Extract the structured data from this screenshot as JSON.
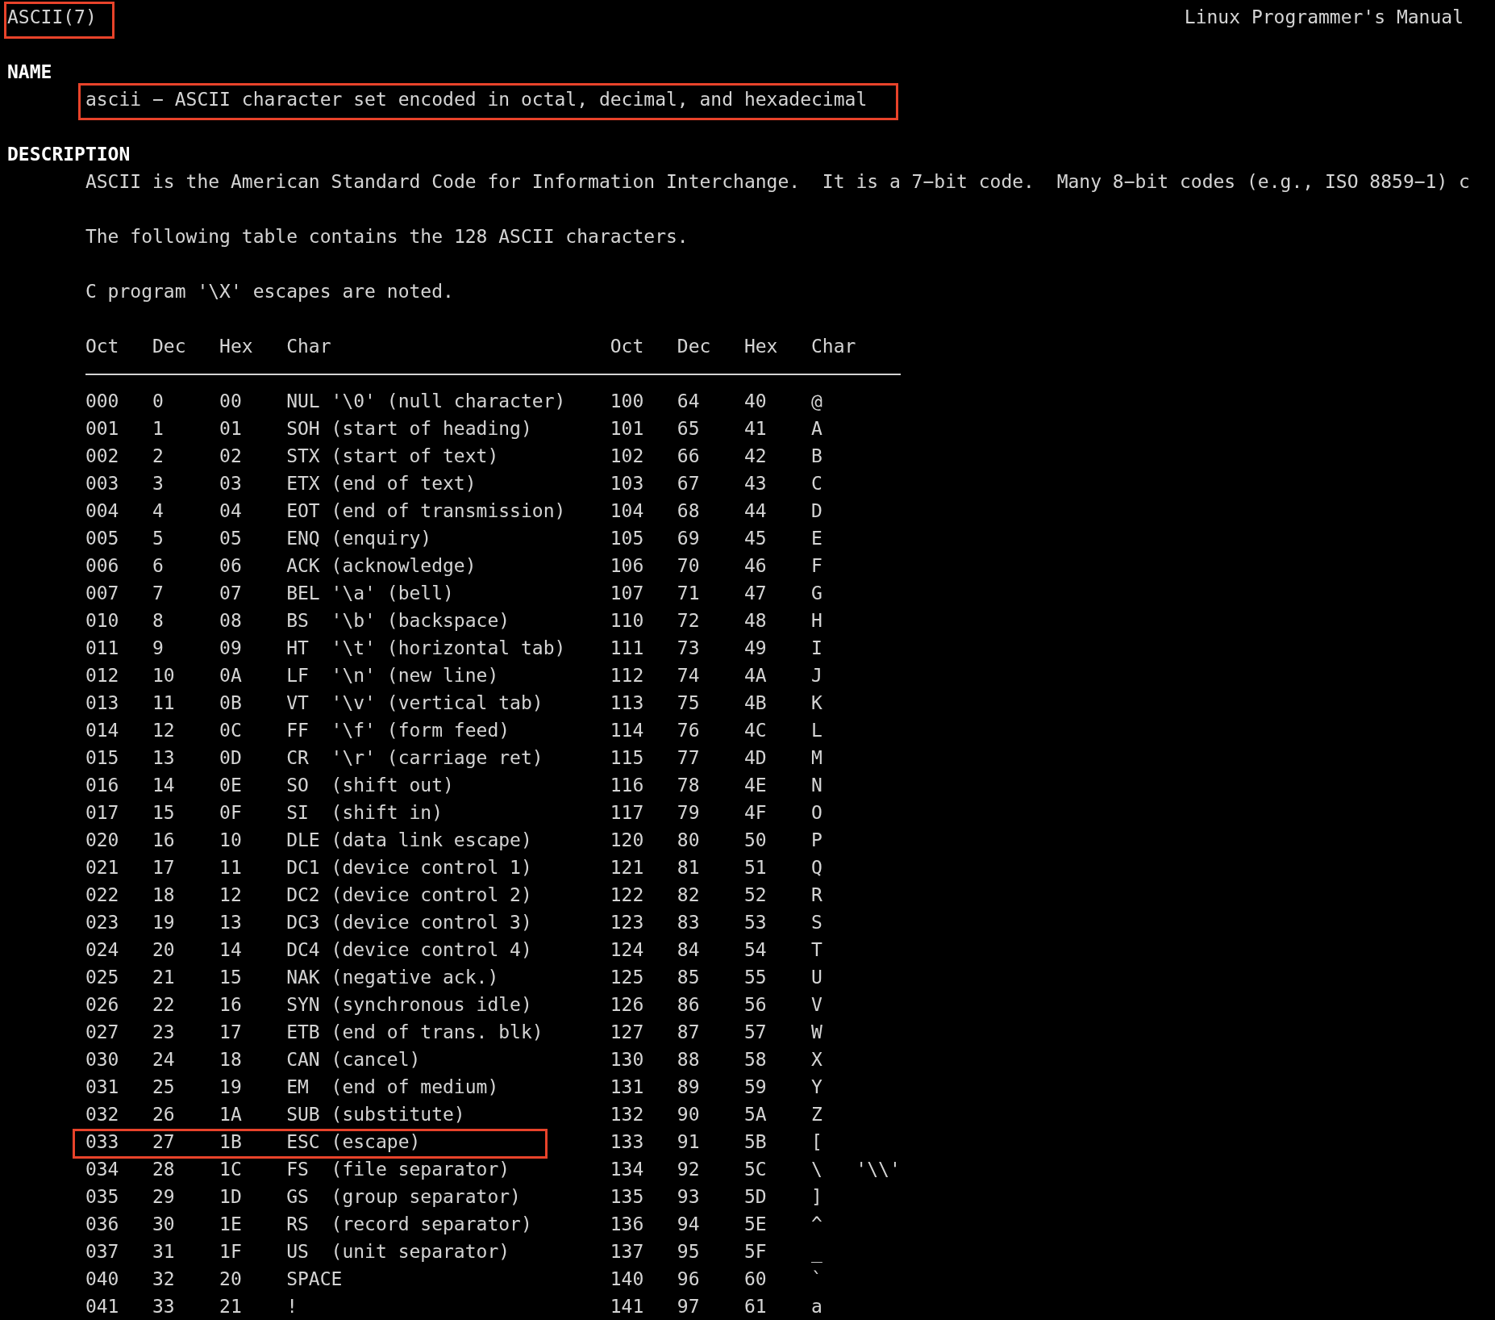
{
  "header": {
    "title": {
      "text": "ASCII(7)",
      "highlighted": true
    },
    "center": "Linux Programmer's Manual"
  },
  "sections": [
    {
      "heading": "NAME",
      "paragraphs": [
        {
          "text": "ascii − ASCII character set encoded in octal, decimal, and hexadecimal",
          "highlighted": true
        }
      ]
    },
    {
      "heading": "DESCRIPTION",
      "paragraphs": [
        {
          "text": "ASCII is the American Standard Code for Information Interchange.  It is a 7−bit code.  Many 8−bit codes (e.g., ISO 8859−1) c",
          "highlighted": false
        },
        {
          "text": "The following table contains the 128 ASCII characters.",
          "highlighted": false
        },
        {
          "text": "C program '\\X' escapes are noted.",
          "highlighted": false
        }
      ]
    }
  ],
  "table": {
    "columns": [
      "Oct",
      "Dec",
      "Hex",
      "Char",
      "Oct",
      "Dec",
      "Hex",
      "Char"
    ],
    "rows": [
      {
        "cells": [
          "000",
          "0",
          "00",
          "NUL '\\0' (null character)",
          "100",
          "64",
          "40",
          "@"
        ],
        "highlighted": false
      },
      {
        "cells": [
          "001",
          "1",
          "01",
          "SOH (start of heading)",
          "101",
          "65",
          "41",
          "A"
        ],
        "highlighted": false
      },
      {
        "cells": [
          "002",
          "2",
          "02",
          "STX (start of text)",
          "102",
          "66",
          "42",
          "B"
        ],
        "highlighted": false
      },
      {
        "cells": [
          "003",
          "3",
          "03",
          "ETX (end of text)",
          "103",
          "67",
          "43",
          "C"
        ],
        "highlighted": false
      },
      {
        "cells": [
          "004",
          "4",
          "04",
          "EOT (end of transmission)",
          "104",
          "68",
          "44",
          "D"
        ],
        "highlighted": false
      },
      {
        "cells": [
          "005",
          "5",
          "05",
          "ENQ (enquiry)",
          "105",
          "69",
          "45",
          "E"
        ],
        "highlighted": false
      },
      {
        "cells": [
          "006",
          "6",
          "06",
          "ACK (acknowledge)",
          "106",
          "70",
          "46",
          "F"
        ],
        "highlighted": false
      },
      {
        "cells": [
          "007",
          "7",
          "07",
          "BEL '\\a' (bell)",
          "107",
          "71",
          "47",
          "G"
        ],
        "highlighted": false
      },
      {
        "cells": [
          "010",
          "8",
          "08",
          "BS  '\\b' (backspace)",
          "110",
          "72",
          "48",
          "H"
        ],
        "highlighted": false
      },
      {
        "cells": [
          "011",
          "9",
          "09",
          "HT  '\\t' (horizontal tab)",
          "111",
          "73",
          "49",
          "I"
        ],
        "highlighted": false
      },
      {
        "cells": [
          "012",
          "10",
          "0A",
          "LF  '\\n' (new line)",
          "112",
          "74",
          "4A",
          "J"
        ],
        "highlighted": false
      },
      {
        "cells": [
          "013",
          "11",
          "0B",
          "VT  '\\v' (vertical tab)",
          "113",
          "75",
          "4B",
          "K"
        ],
        "highlighted": false
      },
      {
        "cells": [
          "014",
          "12",
          "0C",
          "FF  '\\f' (form feed)",
          "114",
          "76",
          "4C",
          "L"
        ],
        "highlighted": false
      },
      {
        "cells": [
          "015",
          "13",
          "0D",
          "CR  '\\r' (carriage ret)",
          "115",
          "77",
          "4D",
          "M"
        ],
        "highlighted": false
      },
      {
        "cells": [
          "016",
          "14",
          "0E",
          "SO  (shift out)",
          "116",
          "78",
          "4E",
          "N"
        ],
        "highlighted": false
      },
      {
        "cells": [
          "017",
          "15",
          "0F",
          "SI  (shift in)",
          "117",
          "79",
          "4F",
          "O"
        ],
        "highlighted": false
      },
      {
        "cells": [
          "020",
          "16",
          "10",
          "DLE (data link escape)",
          "120",
          "80",
          "50",
          "P"
        ],
        "highlighted": false
      },
      {
        "cells": [
          "021",
          "17",
          "11",
          "DC1 (device control 1)",
          "121",
          "81",
          "51",
          "Q"
        ],
        "highlighted": false
      },
      {
        "cells": [
          "022",
          "18",
          "12",
          "DC2 (device control 2)",
          "122",
          "82",
          "52",
          "R"
        ],
        "highlighted": false
      },
      {
        "cells": [
          "023",
          "19",
          "13",
          "DC3 (device control 3)",
          "123",
          "83",
          "53",
          "S"
        ],
        "highlighted": false
      },
      {
        "cells": [
          "024",
          "20",
          "14",
          "DC4 (device control 4)",
          "124",
          "84",
          "54",
          "T"
        ],
        "highlighted": false
      },
      {
        "cells": [
          "025",
          "21",
          "15",
          "NAK (negative ack.)",
          "125",
          "85",
          "55",
          "U"
        ],
        "highlighted": false
      },
      {
        "cells": [
          "026",
          "22",
          "16",
          "SYN (synchronous idle)",
          "126",
          "86",
          "56",
          "V"
        ],
        "highlighted": false
      },
      {
        "cells": [
          "027",
          "23",
          "17",
          "ETB (end of trans. blk)",
          "127",
          "87",
          "57",
          "W"
        ],
        "highlighted": false
      },
      {
        "cells": [
          "030",
          "24",
          "18",
          "CAN (cancel)",
          "130",
          "88",
          "58",
          "X"
        ],
        "highlighted": false
      },
      {
        "cells": [
          "031",
          "25",
          "19",
          "EM  (end of medium)",
          "131",
          "89",
          "59",
          "Y"
        ],
        "highlighted": false
      },
      {
        "cells": [
          "032",
          "26",
          "1A",
          "SUB (substitute)",
          "132",
          "90",
          "5A",
          "Z"
        ],
        "highlighted": false
      },
      {
        "cells": [
          "033",
          "27",
          "1B",
          "ESC (escape)",
          "133",
          "91",
          "5B",
          "["
        ],
        "highlighted": true
      },
      {
        "cells": [
          "034",
          "28",
          "1C",
          "FS  (file separator)",
          "134",
          "92",
          "5C",
          "\\   '\\\\'"
        ],
        "highlighted": false
      },
      {
        "cells": [
          "035",
          "29",
          "1D",
          "GS  (group separator)",
          "135",
          "93",
          "5D",
          "]"
        ],
        "highlighted": false
      },
      {
        "cells": [
          "036",
          "30",
          "1E",
          "RS  (record separator)",
          "136",
          "94",
          "5E",
          "^"
        ],
        "highlighted": false
      },
      {
        "cells": [
          "037",
          "31",
          "1F",
          "US  (unit separator)",
          "137",
          "95",
          "5F",
          "_"
        ],
        "highlighted": false
      },
      {
        "cells": [
          "040",
          "32",
          "20",
          "SPACE",
          "140",
          "96",
          "60",
          "`"
        ],
        "highlighted": false
      },
      {
        "cells": [
          "041",
          "33",
          "21",
          "!",
          "141",
          "97",
          "61",
          "a"
        ],
        "highlighted": false
      }
    ]
  }
}
